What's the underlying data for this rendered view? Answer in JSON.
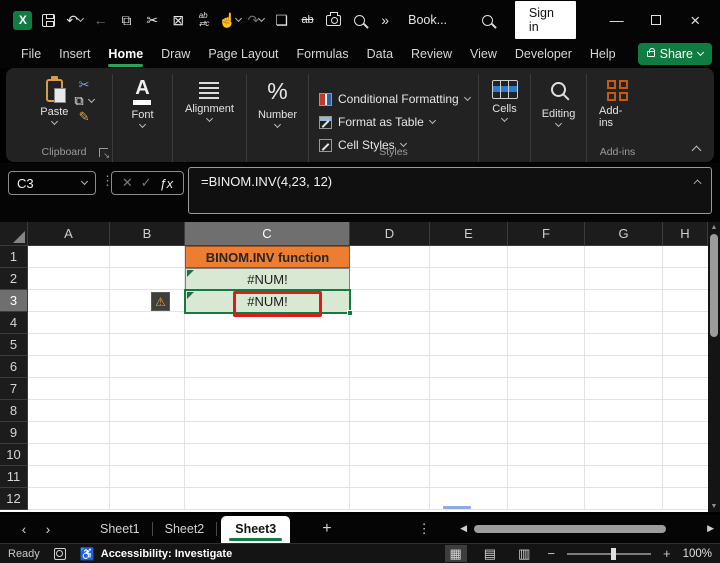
{
  "titlebar": {
    "workbook_name": "Book...",
    "sign_in": "Sign in",
    "more": "»"
  },
  "ribbon": {
    "tabs": [
      {
        "label": "File"
      },
      {
        "label": "Insert"
      },
      {
        "label": "Home",
        "active": true
      },
      {
        "label": "Draw"
      },
      {
        "label": "Page Layout"
      },
      {
        "label": "Formulas"
      },
      {
        "label": "Data"
      },
      {
        "label": "Review"
      },
      {
        "label": "View"
      },
      {
        "label": "Developer"
      },
      {
        "label": "Help"
      }
    ],
    "share": "Share",
    "clipboard": {
      "paste": "Paste",
      "group": "Clipboard"
    },
    "font_group": "Font",
    "font_glyph": "A",
    "alignment_group": "Alignment",
    "number_group": "Number",
    "number_glyph": "%",
    "styles": {
      "conditional": "Conditional Formatting",
      "format_table": "Format as Table",
      "cell_styles": "Cell Styles",
      "group": "Styles"
    },
    "cells_group": "Cells",
    "editing_group": "Editing",
    "addins": {
      "label": "Add-ins",
      "group": "Add-ins"
    }
  },
  "formula_bar": {
    "name_box": "C3",
    "fx": "ƒx",
    "formula": "=BINOM.INV(4,23, 12)"
  },
  "grid": {
    "columns": [
      "A",
      "B",
      "C",
      "D",
      "E",
      "F",
      "G",
      "H"
    ],
    "rows": [
      "1",
      "2",
      "3",
      "4",
      "5",
      "6",
      "7",
      "8",
      "9",
      "10",
      "11",
      "12"
    ],
    "selected_cell": "C3",
    "selected_column": "C",
    "selected_row": "3",
    "c1": {
      "text": "BINOM.INV function",
      "fill": "#ED7D31"
    },
    "c2": {
      "text": "#NUM!",
      "fill": "#D9E8D2",
      "error_flag": true
    },
    "c3": {
      "text": "#NUM!",
      "fill": "#D9E8D2",
      "error_flag": true,
      "annotation": "red-box"
    },
    "colors": {
      "selection_green": "#107C41",
      "annotation_red": "#DF1A1A",
      "warning_amber": "#ECA13C",
      "header_orange": "#ED7D31",
      "result_green": "#D9E8D2"
    }
  },
  "sheets": {
    "items": [
      "Sheet1",
      "Sheet2",
      "Sheet3"
    ],
    "active": "Sheet3",
    "add": "+"
  },
  "status_bar": {
    "mode": "Ready",
    "accessibility": "Accessibility: Investigate",
    "zoom_out": "−",
    "zoom_in": "+",
    "zoom": "100%"
  }
}
